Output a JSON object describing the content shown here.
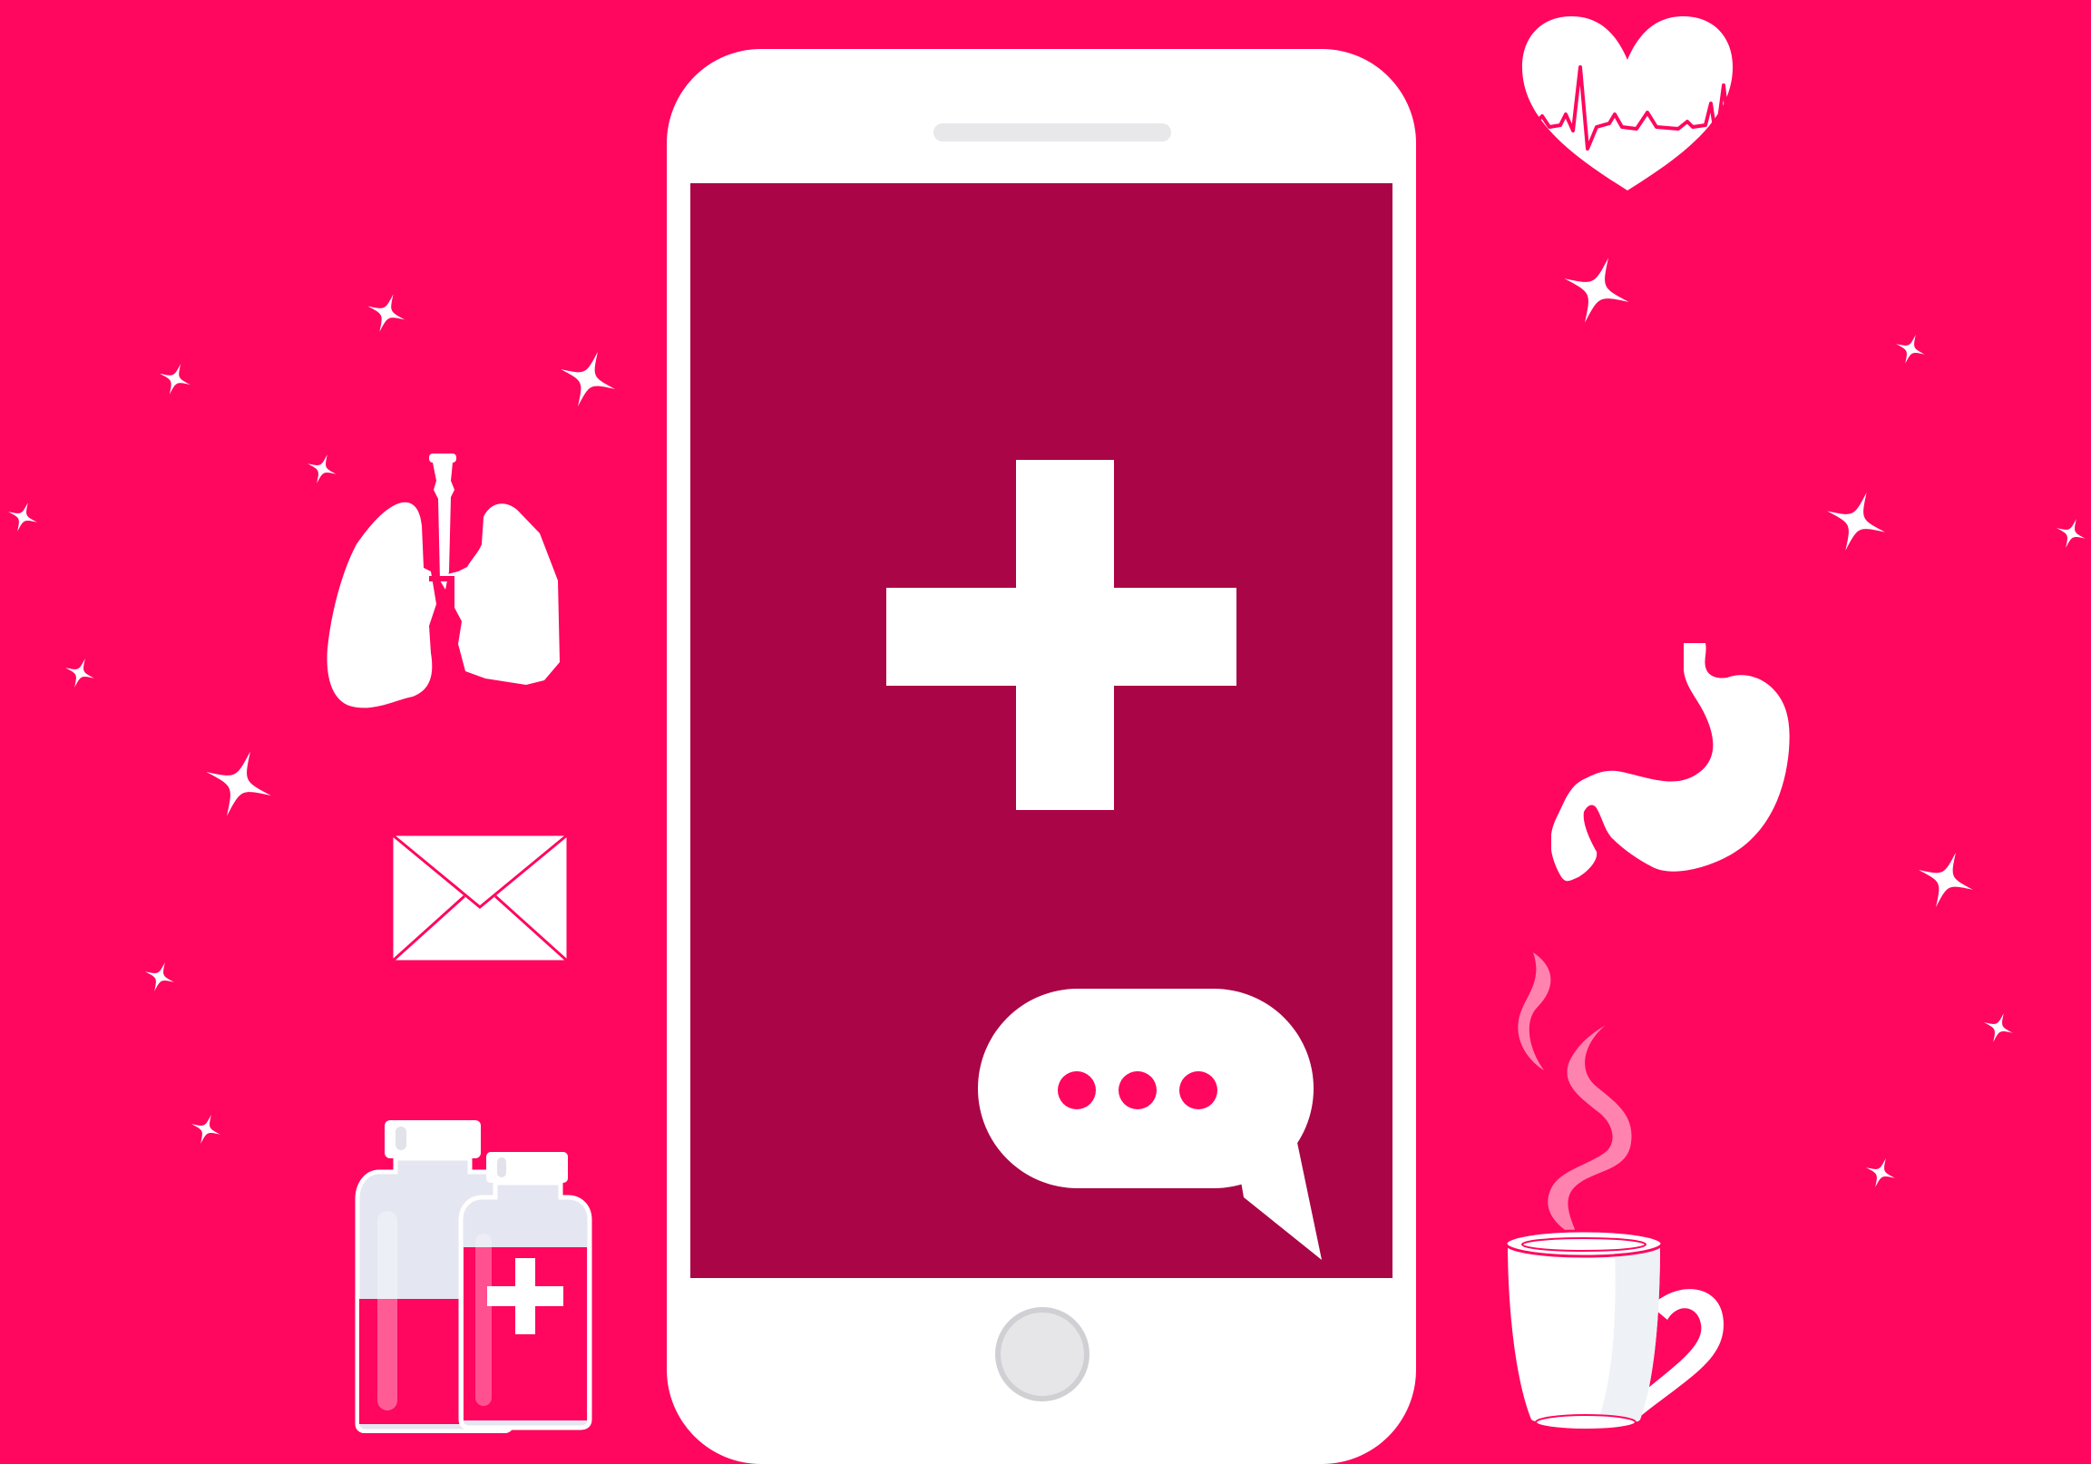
{
  "colors": {
    "background": "#ff065f",
    "screen": "#aa0547",
    "phone_body": "#ffffff",
    "accent_pink": "#ff065f"
  },
  "icons": {
    "medical_cross": "medical-cross-icon",
    "chat_bubble": "typing-chat-bubble-icon",
    "lungs": "lungs-icon",
    "envelope": "envelope-icon",
    "medicine_bottles": "medicine-bottles-icon",
    "heartbeat": "heartbeat-heart-icon",
    "stomach": "stomach-icon",
    "coffee_cup": "hot-drink-cup-icon",
    "sparkle": "sparkle-icon"
  }
}
